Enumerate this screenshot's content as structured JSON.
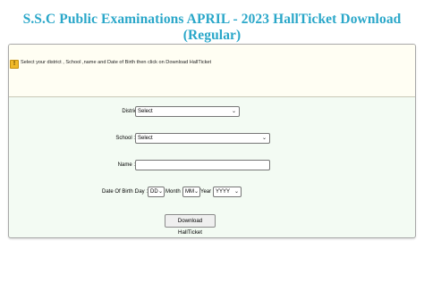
{
  "page": {
    "title": "S.S.C Public Examinations APRIL - 2023 HallTicket Download (Regular)"
  },
  "notice": {
    "icon": "warning-icon",
    "text": "Select your district , School ,name  and Date of Birth then click on Download HallTicket"
  },
  "form": {
    "district": {
      "label": "District :",
      "value": "Select"
    },
    "school": {
      "label": "School :",
      "value": "Select"
    },
    "name": {
      "label": "Name :",
      "value": ""
    },
    "dob": {
      "label": "Date Of Birth :",
      "day_label": "Day :",
      "day_value": "DD",
      "month_label": "Month :",
      "month_value": "MM",
      "year_label": "Year :",
      "year_value": "YYYY"
    },
    "submit_label": "Download HallTicket"
  },
  "colors": {
    "title": "#2aa7c9",
    "notice_bg": "#fffef3",
    "form_bg": "#f3fbf3"
  }
}
